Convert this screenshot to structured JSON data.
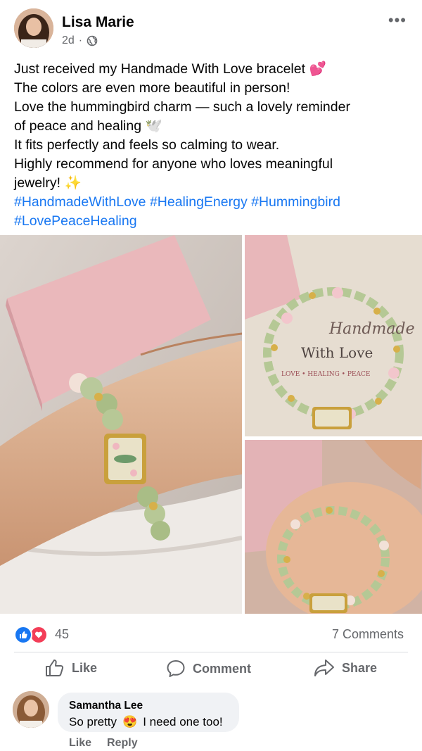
{
  "post": {
    "author": "Lisa Marie",
    "time": "2d",
    "separator": "·",
    "more_label": "•••",
    "lines": [
      "Just received my Handmade With Love bracelet 💕",
      "The colors are even more beautiful in person!",
      "Love the hummingbird charm — such a lovely reminder",
      "of peace and healing 🕊️",
      "It fits perfectly and feels so calming to wear.",
      "Highly recommend for anyone who loves meaningful",
      "jewelry! ✨"
    ],
    "hashtags_line1": "#HandmadeWithLove #HealingEnergy #Hummingbird",
    "hashtags_line2": "#LovePeaceHealing"
  },
  "photos": {
    "box_text_1": "Handmade",
    "box_text_2": "With Love",
    "box_text_3": "LOVE • HEALING • PEACE"
  },
  "stats": {
    "reaction_count": "45",
    "comments_label": "7 Comments"
  },
  "actions": {
    "like": "Like",
    "comment": "Comment",
    "share": "Share"
  },
  "comment": {
    "name": "Samantha Lee",
    "text_before": "So pretty",
    "emoji": "😍",
    "text_after": "I need one too!",
    "like": "Like",
    "reply": "Reply"
  },
  "colors": {
    "link": "#1877f2",
    "like": "#1877f2",
    "love": "#f33e58",
    "secondary_text": "#65676b"
  }
}
